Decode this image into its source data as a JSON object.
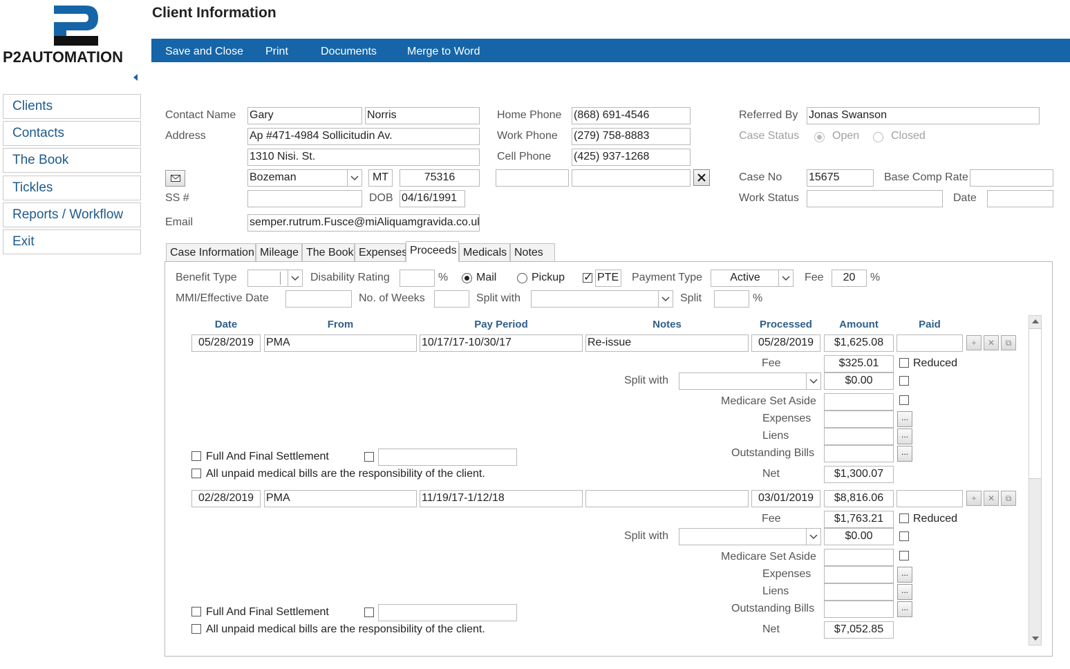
{
  "app": {
    "logo_mark": "P2",
    "logo_text": "P2AUTOMATION",
    "page_title": "Client Information"
  },
  "toolbar": {
    "save_close": "Save and Close",
    "print": "Print",
    "documents": "Documents",
    "merge": "Merge to Word"
  },
  "nav": [
    "Clients",
    "Contacts",
    "The Book",
    "Tickles",
    "Reports / Workflow",
    "Exit"
  ],
  "contact": {
    "contact_name_label": "Contact Name",
    "first_name": "Gary",
    "last_name": "Norris",
    "address_label": "Address",
    "address1": "Ap #471-4984 Sollicitudin Av.",
    "address2": "1310 Nisi. St.",
    "city": "Bozeman",
    "state": "MT",
    "zip": "75316",
    "ss_label": "SS #",
    "ss": "",
    "dob_label": "DOB",
    "dob": "04/16/1991",
    "email_label": "Email",
    "email": "semper.rutrum.Fusce@miAliquamgravida.co.uk"
  },
  "phones": {
    "home_label": "Home Phone",
    "home": "(868) 691-4546",
    "work_label": "Work Phone",
    "work": "(279) 758-8883",
    "cell_label": "Cell Phone",
    "cell": "(425) 937-1268"
  },
  "case": {
    "referred_label": "Referred By",
    "referred_by": "Jonas Swanson",
    "status_label": "Case Status",
    "open": "Open",
    "closed": "Closed",
    "case_no_label": "Case No",
    "case_no": "15675",
    "base_comp_label": "Base Comp Rate",
    "work_status_label": "Work Status",
    "date_label": "Date"
  },
  "tabs": [
    "Case Information",
    "Mileage",
    "The Book",
    "Expenses",
    "Proceeds",
    "Medicals",
    "Notes"
  ],
  "proceeds": {
    "benefit_type_label": "Benefit Type",
    "disability_rating_label": "Disability Rating",
    "percent": "%",
    "mail": "Mail",
    "pickup": "Pickup",
    "pte": "PTE",
    "payment_type_label": "Payment Type",
    "payment_type": "Active",
    "fee_label": "Fee",
    "fee": "20",
    "mmi_label": "MMI/Effective Date",
    "weeks_label": "No. of Weeks",
    "split_with_label": "Split with",
    "split_label": "Split",
    "columns": [
      "Date",
      "From",
      "Pay Period",
      "Notes",
      "Processed",
      "Amount",
      "Paid"
    ],
    "detail_labels": {
      "fee": "Fee",
      "split_with": "Split with",
      "medicare": "Medicare Set Aside",
      "expenses": "Expenses",
      "liens": "Liens",
      "outstanding": "Outstanding Bills",
      "net": "Net",
      "reduced": "Reduced",
      "full_final": "Full And Final Settlement",
      "unpaid": "All unpaid medical bills are the responsibility of the client.",
      "dots": "..."
    },
    "rows": [
      {
        "date": "05/28/2019",
        "from": "PMA",
        "pay_period": "10/17/17-10/30/17",
        "notes": "Re-issue",
        "processed": "05/28/2019",
        "amount": "$1,625.08",
        "fee": "$325.01",
        "split": "$0.00",
        "net": "$1,300.07"
      },
      {
        "date": "02/28/2019",
        "from": "PMA",
        "pay_period": "11/19/17-1/12/18",
        "notes": "",
        "processed": "03/01/2019",
        "amount": "$8,816.06",
        "fee": "$1,763.21",
        "split": "$0.00",
        "net": "$7,052.85"
      }
    ]
  },
  "colors": {
    "toolbar": "#1565a8",
    "nav_text": "#1e5a8c",
    "header_text": "#2e5f8a"
  }
}
